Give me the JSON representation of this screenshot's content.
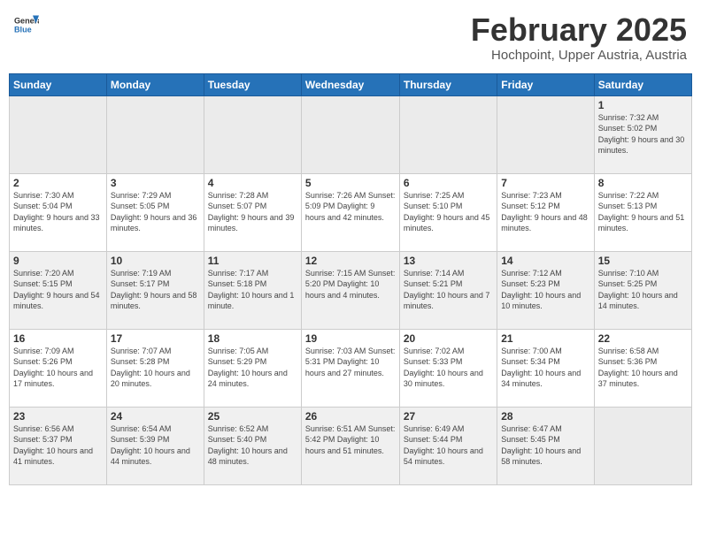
{
  "header": {
    "logo_general": "General",
    "logo_blue": "Blue",
    "month": "February 2025",
    "location": "Hochpoint, Upper Austria, Austria"
  },
  "weekdays": [
    "Sunday",
    "Monday",
    "Tuesday",
    "Wednesday",
    "Thursday",
    "Friday",
    "Saturday"
  ],
  "weeks": [
    [
      {
        "day": "",
        "info": ""
      },
      {
        "day": "",
        "info": ""
      },
      {
        "day": "",
        "info": ""
      },
      {
        "day": "",
        "info": ""
      },
      {
        "day": "",
        "info": ""
      },
      {
        "day": "",
        "info": ""
      },
      {
        "day": "1",
        "info": "Sunrise: 7:32 AM\nSunset: 5:02 PM\nDaylight: 9 hours and 30 minutes."
      }
    ],
    [
      {
        "day": "2",
        "info": "Sunrise: 7:30 AM\nSunset: 5:04 PM\nDaylight: 9 hours and 33 minutes."
      },
      {
        "day": "3",
        "info": "Sunrise: 7:29 AM\nSunset: 5:05 PM\nDaylight: 9 hours and 36 minutes."
      },
      {
        "day": "4",
        "info": "Sunrise: 7:28 AM\nSunset: 5:07 PM\nDaylight: 9 hours and 39 minutes."
      },
      {
        "day": "5",
        "info": "Sunrise: 7:26 AM\nSunset: 5:09 PM\nDaylight: 9 hours and 42 minutes."
      },
      {
        "day": "6",
        "info": "Sunrise: 7:25 AM\nSunset: 5:10 PM\nDaylight: 9 hours and 45 minutes."
      },
      {
        "day": "7",
        "info": "Sunrise: 7:23 AM\nSunset: 5:12 PM\nDaylight: 9 hours and 48 minutes."
      },
      {
        "day": "8",
        "info": "Sunrise: 7:22 AM\nSunset: 5:13 PM\nDaylight: 9 hours and 51 minutes."
      }
    ],
    [
      {
        "day": "9",
        "info": "Sunrise: 7:20 AM\nSunset: 5:15 PM\nDaylight: 9 hours and 54 minutes."
      },
      {
        "day": "10",
        "info": "Sunrise: 7:19 AM\nSunset: 5:17 PM\nDaylight: 9 hours and 58 minutes."
      },
      {
        "day": "11",
        "info": "Sunrise: 7:17 AM\nSunset: 5:18 PM\nDaylight: 10 hours and 1 minute."
      },
      {
        "day": "12",
        "info": "Sunrise: 7:15 AM\nSunset: 5:20 PM\nDaylight: 10 hours and 4 minutes."
      },
      {
        "day": "13",
        "info": "Sunrise: 7:14 AM\nSunset: 5:21 PM\nDaylight: 10 hours and 7 minutes."
      },
      {
        "day": "14",
        "info": "Sunrise: 7:12 AM\nSunset: 5:23 PM\nDaylight: 10 hours and 10 minutes."
      },
      {
        "day": "15",
        "info": "Sunrise: 7:10 AM\nSunset: 5:25 PM\nDaylight: 10 hours and 14 minutes."
      }
    ],
    [
      {
        "day": "16",
        "info": "Sunrise: 7:09 AM\nSunset: 5:26 PM\nDaylight: 10 hours and 17 minutes."
      },
      {
        "day": "17",
        "info": "Sunrise: 7:07 AM\nSunset: 5:28 PM\nDaylight: 10 hours and 20 minutes."
      },
      {
        "day": "18",
        "info": "Sunrise: 7:05 AM\nSunset: 5:29 PM\nDaylight: 10 hours and 24 minutes."
      },
      {
        "day": "19",
        "info": "Sunrise: 7:03 AM\nSunset: 5:31 PM\nDaylight: 10 hours and 27 minutes."
      },
      {
        "day": "20",
        "info": "Sunrise: 7:02 AM\nSunset: 5:33 PM\nDaylight: 10 hours and 30 minutes."
      },
      {
        "day": "21",
        "info": "Sunrise: 7:00 AM\nSunset: 5:34 PM\nDaylight: 10 hours and 34 minutes."
      },
      {
        "day": "22",
        "info": "Sunrise: 6:58 AM\nSunset: 5:36 PM\nDaylight: 10 hours and 37 minutes."
      }
    ],
    [
      {
        "day": "23",
        "info": "Sunrise: 6:56 AM\nSunset: 5:37 PM\nDaylight: 10 hours and 41 minutes."
      },
      {
        "day": "24",
        "info": "Sunrise: 6:54 AM\nSunset: 5:39 PM\nDaylight: 10 hours and 44 minutes."
      },
      {
        "day": "25",
        "info": "Sunrise: 6:52 AM\nSunset: 5:40 PM\nDaylight: 10 hours and 48 minutes."
      },
      {
        "day": "26",
        "info": "Sunrise: 6:51 AM\nSunset: 5:42 PM\nDaylight: 10 hours and 51 minutes."
      },
      {
        "day": "27",
        "info": "Sunrise: 6:49 AM\nSunset: 5:44 PM\nDaylight: 10 hours and 54 minutes."
      },
      {
        "day": "28",
        "info": "Sunrise: 6:47 AM\nSunset: 5:45 PM\nDaylight: 10 hours and 58 minutes."
      },
      {
        "day": "",
        "info": ""
      }
    ]
  ]
}
